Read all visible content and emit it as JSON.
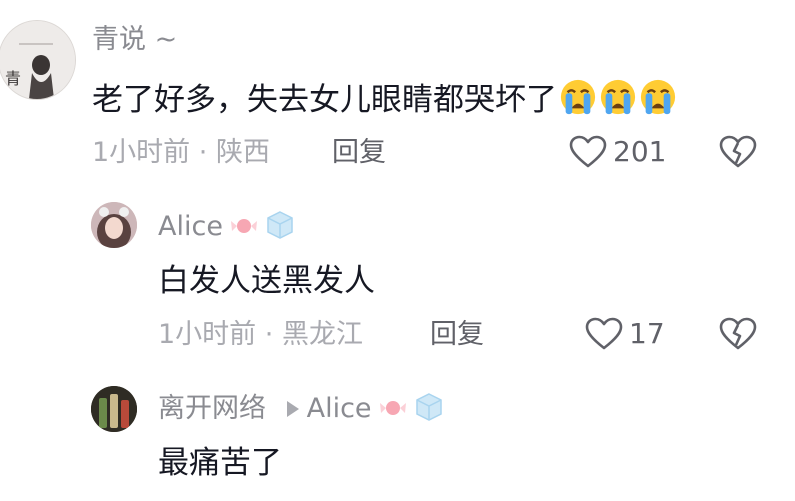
{
  "comments": [
    {
      "username": "青说 ~",
      "text": "老了好多，失去女儿眼睛都哭坏了",
      "emojis": [
        "crying-face",
        "crying-face",
        "crying-face"
      ],
      "time": "1小时前",
      "location": "陕西",
      "reply_label": "回复",
      "likes": "201"
    },
    {
      "username": "Alice",
      "text": "白发人送黑发人",
      "time": "1小时前",
      "location": "黑龙江",
      "reply_label": "回复",
      "likes": "17"
    },
    {
      "username": "离开网络",
      "reply_to": "Alice",
      "text": "最痛苦了"
    }
  ],
  "avatar_text": "青",
  "separator": "·",
  "colors": {
    "username": "#8a8b91",
    "body_text": "#161823",
    "meta": "#a9aab0",
    "action": "#606168",
    "background": "#ffffff"
  }
}
